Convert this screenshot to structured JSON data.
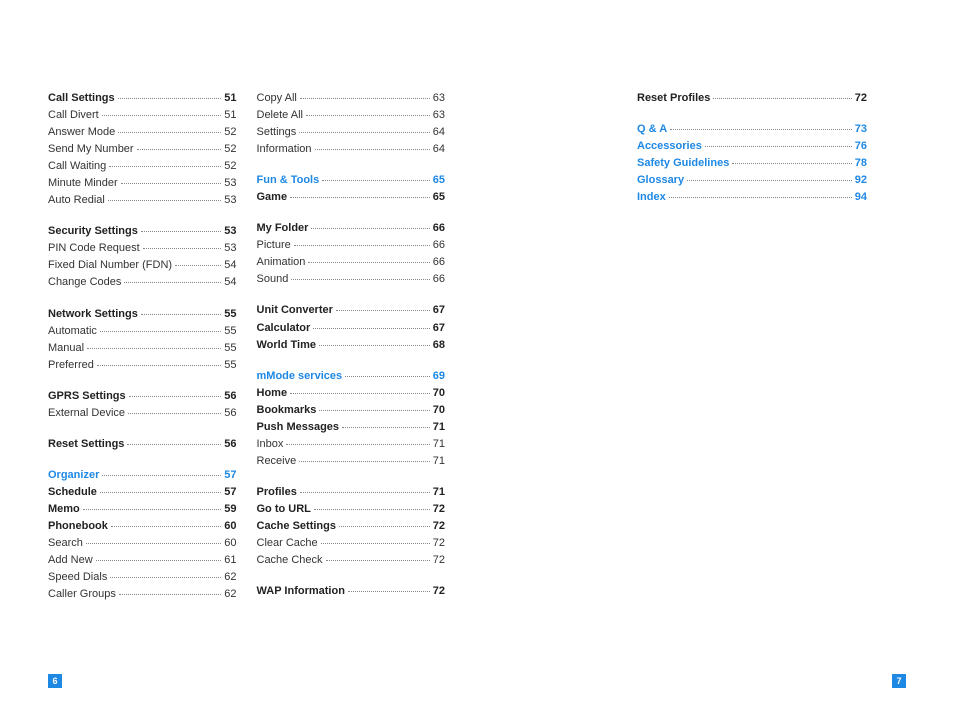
{
  "pages": {
    "leftNum": "6",
    "rightNum": "7"
  },
  "col1": {
    "g1": [
      {
        "label": "Call Settings",
        "pg": "51",
        "style": "bold"
      },
      {
        "label": "Call Divert",
        "pg": "51"
      },
      {
        "label": "Answer Mode",
        "pg": "52"
      },
      {
        "label": "Send My Number",
        "pg": "52"
      },
      {
        "label": "Call Waiting",
        "pg": "52"
      },
      {
        "label": "Minute Minder",
        "pg": "53"
      },
      {
        "label": "Auto Redial",
        "pg": "53"
      }
    ],
    "g2": [
      {
        "label": "Security Settings",
        "pg": "53",
        "style": "bold"
      },
      {
        "label": "PIN Code Request",
        "pg": "53"
      },
      {
        "label": "Fixed Dial Number (FDN)",
        "pg": "54"
      },
      {
        "label": "Change Codes",
        "pg": "54"
      }
    ],
    "g3": [
      {
        "label": "Network Settings",
        "pg": "55",
        "style": "bold"
      },
      {
        "label": "Automatic",
        "pg": "55"
      },
      {
        "label": "Manual",
        "pg": "55"
      },
      {
        "label": "Preferred",
        "pg": "55"
      }
    ],
    "g4": [
      {
        "label": "GPRS Settings",
        "pg": "56",
        "style": "bold"
      },
      {
        "label": "External Device",
        "pg": "56"
      }
    ],
    "g5": [
      {
        "label": "Reset Settings",
        "pg": "56",
        "style": "bold"
      }
    ],
    "g6": [
      {
        "label": "Organizer",
        "pg": "57",
        "style": "blue"
      },
      {
        "label": "Schedule",
        "pg": "57",
        "style": "bold"
      },
      {
        "label": "Memo",
        "pg": "59",
        "style": "bold"
      },
      {
        "label": "Phonebook",
        "pg": "60",
        "style": "bold"
      },
      {
        "label": "Search",
        "pg": "60"
      },
      {
        "label": "Add New",
        "pg": "61"
      },
      {
        "label": "Speed Dials",
        "pg": "62"
      },
      {
        "label": "Caller Groups",
        "pg": "62"
      }
    ]
  },
  "col2": {
    "g1": [
      {
        "label": "Copy All",
        "pg": "63"
      },
      {
        "label": "Delete All",
        "pg": "63"
      },
      {
        "label": "Settings",
        "pg": "64"
      },
      {
        "label": "Information",
        "pg": "64"
      }
    ],
    "g2": [
      {
        "label": "Fun & Tools",
        "pg": "65",
        "style": "blue"
      },
      {
        "label": "Game",
        "pg": "65",
        "style": "bold"
      }
    ],
    "g3": [
      {
        "label": "My Folder",
        "pg": "66",
        "style": "bold"
      },
      {
        "label": "Picture",
        "pg": "66"
      },
      {
        "label": "Animation",
        "pg": "66"
      },
      {
        "label": "Sound",
        "pg": "66"
      }
    ],
    "g4": [
      {
        "label": "Unit Converter",
        "pg": "67",
        "style": "bold"
      },
      {
        "label": "Calculator",
        "pg": "67",
        "style": "bold"
      },
      {
        "label": "World Time",
        "pg": "68",
        "style": "bold"
      }
    ],
    "g5": [
      {
        "label": "mMode services",
        "pg": "69",
        "style": "blue"
      },
      {
        "label": "Home",
        "pg": "70",
        "style": "bold"
      },
      {
        "label": "Bookmarks",
        "pg": "70",
        "style": "bold"
      },
      {
        "label": "Push Messages",
        "pg": "71",
        "style": "bold"
      },
      {
        "label": "Inbox",
        "pg": "71"
      },
      {
        "label": "Receive",
        "pg": "71"
      }
    ],
    "g6": [
      {
        "label": "Profiles",
        "pg": "71",
        "style": "bold"
      },
      {
        "label": "Go to URL",
        "pg": "72",
        "style": "bold"
      },
      {
        "label": "Cache Settings",
        "pg": "72",
        "style": "bold"
      },
      {
        "label": "Clear Cache",
        "pg": "72"
      },
      {
        "label": "Cache Check",
        "pg": "72"
      }
    ],
    "g7": [
      {
        "label": "WAP Information",
        "pg": "72",
        "style": "bold"
      }
    ]
  },
  "col3": {
    "g1": [
      {
        "label": "Reset Profiles",
        "pg": "72",
        "style": "bold"
      }
    ],
    "g2": [
      {
        "label": "Q & A",
        "pg": "73",
        "style": "blue"
      },
      {
        "label": "Accessories",
        "pg": "76",
        "style": "blue"
      },
      {
        "label": "Safety Guidelines",
        "pg": "78",
        "style": "blue"
      },
      {
        "label": "Glossary",
        "pg": "92",
        "style": "blue"
      },
      {
        "label": "Index",
        "pg": "94",
        "style": "blue"
      }
    ]
  }
}
